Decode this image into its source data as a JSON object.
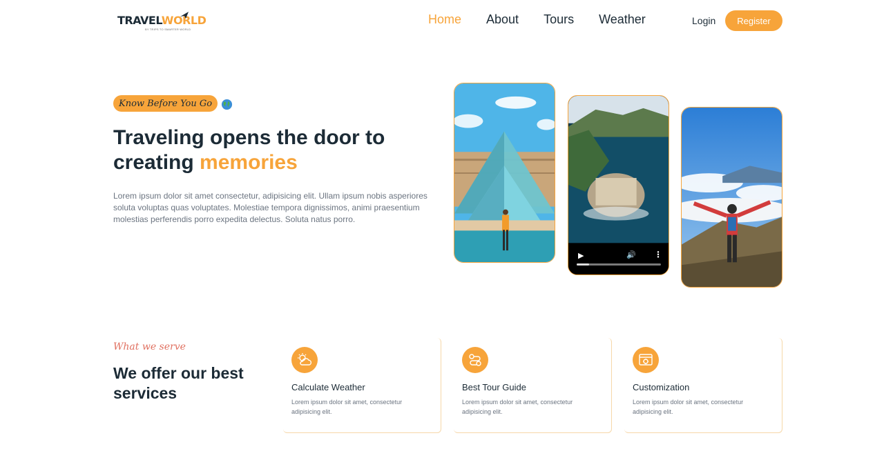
{
  "header": {
    "logo": {
      "word1": "TRAVEL",
      "word2": "WORLD",
      "tagline": "BY TRIPS TO SMARTER WORLD"
    },
    "nav": [
      {
        "label": "Home",
        "active": true
      },
      {
        "label": "About",
        "active": false
      },
      {
        "label": "Tours",
        "active": false
      },
      {
        "label": "Weather",
        "active": false
      }
    ],
    "login_label": "Login",
    "register_label": "Register"
  },
  "hero": {
    "badge": "Know Before You Go",
    "title_part1": "Traveling opens the door to creating ",
    "title_highlight": "memories",
    "text": "Lorem ipsum dolor sit amet consectetur, adipisicing elit. Ullam ipsum nobis asperiores soluta voluptas quas voluptates. Molestiae tempora dignissimos, animi praesentium molestias perferendis porro expedita delectus. Soluta natus porro.",
    "video_progress": 0.15
  },
  "services": {
    "subtitle": "What we serve",
    "title": "We offer our best services",
    "cards": [
      {
        "icon": "weather-icon",
        "title": "Calculate Weather",
        "text": "Lorem ipsum dolor sit amet, consectetur adipisicing elit."
      },
      {
        "icon": "guide-icon",
        "title": "Best Tour Guide",
        "text": "Lorem ipsum dolor sit amet, consectetur adipisicing elit."
      },
      {
        "icon": "customize-icon",
        "title": "Customization",
        "text": "Lorem ipsum dolor sit amet, consectetur adipisicing elit."
      }
    ]
  },
  "colors": {
    "accent": "#f7a43a",
    "heading": "#1c2b36",
    "body": "#6b7480",
    "subtitle": "#e07060"
  }
}
